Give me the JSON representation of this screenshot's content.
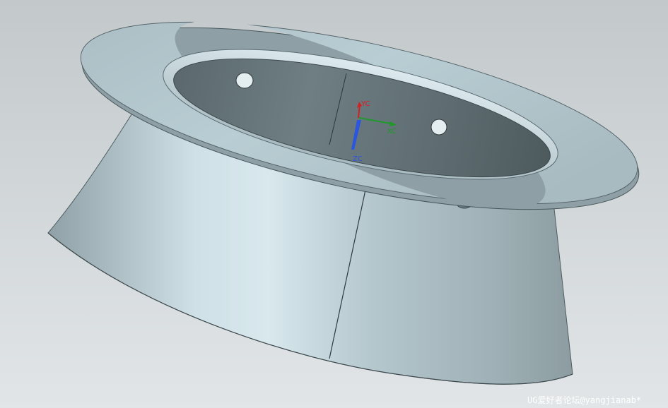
{
  "viewport": {
    "background_top": "#c4cacc",
    "background_bottom": "#dfe3e5",
    "model_color": "#b8ccd3",
    "edge_color": "#2d3a3f"
  },
  "triad": {
    "x_label": "YC",
    "y_label": "XC",
    "z_label": "ZC",
    "x_color": "#d42020",
    "y_color": "#1f9a2a",
    "z_color": "#2a56e0"
  },
  "watermark": {
    "text": "UG爱好者论坛@yangjianab*"
  }
}
